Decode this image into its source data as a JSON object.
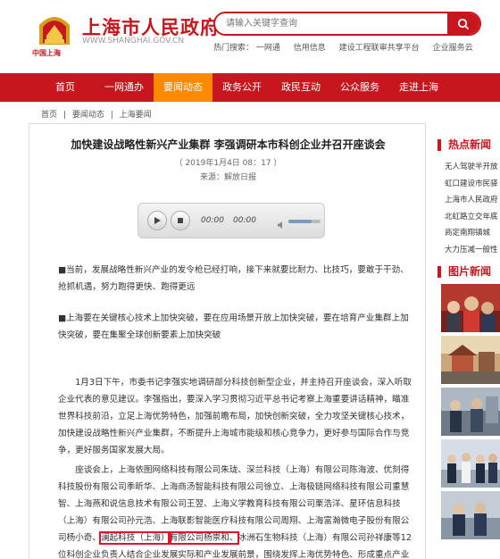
{
  "header": {
    "logo_label": "1949",
    "logo_subtitle": "中国上海",
    "title": "上海市人民政府",
    "url": "WWW.SHANGHAI.GOV.CN",
    "search_placeholder": "请输入关键字查询",
    "hot_label": "热门搜索：",
    "hot_links": [
      "一网通",
      "信用信息",
      "建设工程联审共享平台",
      "企业服务云"
    ]
  },
  "nav": {
    "items": [
      "首页",
      "一网通办",
      "要闻动态",
      "政务公开",
      "政民互动",
      "公众服务",
      "走进上海"
    ],
    "active_index": 2
  },
  "breadcrumb": [
    "首页",
    "|",
    "要闻动态",
    "|",
    "上海要闻"
  ],
  "article": {
    "title": "加快建设战略性新兴产业集群 李强调研本市科创企业并召开座谈会",
    "date": "（ 2019年1月4日 08：17 ）",
    "source": "来源：解放日报",
    "player": {
      "current": "00:00",
      "total": "00:00"
    },
    "p1": "■当前，发展战略性新兴产业的发令枪已经打响，接下来就要比耐力、比技巧，要敢于干劲、抢抓机遇，努力跑得更快、跑得更远",
    "p2": "■上海要在关键核心技术上加快突破，要在应用场景开放上加快突破，要在培育产业集群上加快突破，要在集聚全球创新要素上加快突破",
    "p3": "1月3日下午，市委书记李强实地调研部分科技创新型企业，并主持召开座谈会，深入听取企业代表的意见建议。李强指出，要深入学习贯彻习近平总书记考察上海重要讲话精神，瞄准世界科技前沿，立足上海优势特色，加强前瞻布局，加快创新突破，全力攻坚关键核心技术，加快建设战略性新兴产业集群，不断提升上海城市能级和核心竞争力，更好参与国际合作与竞争，更好服务国家发展大局。",
    "p4_a": "座谈会上，上海依图网络科技有限公司朱珑、深兰科技（上海）有限公司陈海波、优刻得科技股份有限公司季昕华、上海商汤智能科技有限公司徐立、上海极链网络科技有限公司重慧智、上海燕和说信息技术有限公司王翌、上海义学教育科技有限公司栗浩洋、星环信息科技（上海）有限公司孙元浩、上海联影智能医疗科技有限公司周翔、上海富瀚微电子股份有限公司杨小奇、",
    "p4_hl1": "澜起科技（上海）",
    "p4_hl2": "有限公司杨崇和、",
    "p4_b": "冰洲石生物科技（上海）有限公司孙祥康等12位科创企业负责人结合企业发展实际和产业发展前景，围绕发挥上海优势特色、形成重点产业发力点开门见山谈想法、说实情、提建议。"
  },
  "sidebar": {
    "hot_title": "热点新闻",
    "hot_news": [
      "无人驾驶半开放",
      "虹口建设市民驿",
      "上海市人民政府",
      "北虹路立交年底",
      "商定南翔镇城",
      "大力压减一般性"
    ],
    "photo_title": "图片新闻"
  }
}
